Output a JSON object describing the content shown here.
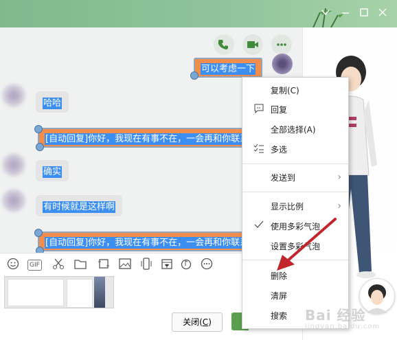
{
  "titlebar": {
    "controls": [
      "chevron-down-icon",
      "minimize-icon",
      "maximize-icon",
      "close-icon"
    ]
  },
  "chat": {
    "top_buttons": [
      "phone-icon",
      "video-icon",
      "more-icon"
    ],
    "messages": {
      "m1": "可以考虑一下",
      "m2": "哈哈",
      "m3": "[自动回复]你好，我现在有事不在，一会再和你联系",
      "m4": "确实",
      "m5": "有时候就是这样啊",
      "m6": "[自动回复]你好，我现在有事不在，一会再和你联系"
    }
  },
  "toolbar": {
    "icons": [
      "emoji-icon",
      "gif-icon",
      "scissors-icon",
      "folder-icon",
      "screenshot-icon",
      "image-icon",
      "phone-shake-icon",
      "calendar-icon",
      "music-icon",
      "more-icon"
    ],
    "gif_label": "GIF"
  },
  "input": {
    "close_label": "关闭(",
    "close_key": "C",
    "close_end": ")"
  },
  "menu": {
    "copy": "复制(C)",
    "reply": "回复",
    "select_all": "全部选择(A)",
    "multi_select": "多选",
    "send_to": "发送到",
    "display_ratio": "显示比例",
    "use_bubble": "使用多彩气泡",
    "set_bubble": "设置多彩气泡",
    "delete": "删除",
    "clear": "清屏",
    "search": "搜索"
  },
  "watermark": {
    "brand": "Bai 经验",
    "url": "jingyan.baidu.com"
  },
  "colors": {
    "titlebar": "#8fc49a",
    "selection": "#3c8ff0",
    "bubble_orange": "#f18e4e",
    "send_button": "#5a9e4e",
    "arrow": "#c0262c"
  }
}
